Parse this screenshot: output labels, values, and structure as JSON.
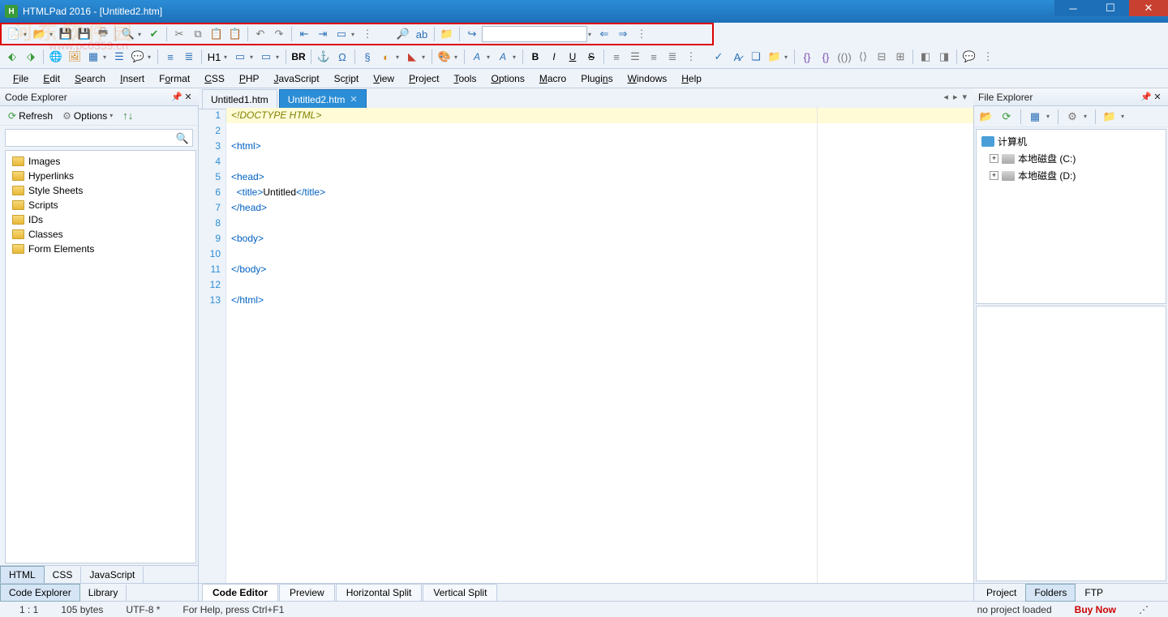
{
  "titlebar": {
    "app": "HTMLPad 2016",
    "doc": "[Untitled2.htm]"
  },
  "watermark": {
    "line1": "河 东 软 件 园",
    "line2": "www.pc0359.cn"
  },
  "menubar": [
    "File",
    "Edit",
    "Search",
    "Insert",
    "Format",
    "CSS",
    "PHP",
    "JavaScript",
    "Script",
    "View",
    "Project",
    "Tools",
    "Options",
    "Macro",
    "Plugins",
    "Windows",
    "Help"
  ],
  "code_explorer": {
    "title": "Code Explorer",
    "refresh": "Refresh",
    "options": "Options",
    "search_placeholder": "",
    "items": [
      "Images",
      "Hyperlinks",
      "Style Sheets",
      "Scripts",
      "IDs",
      "Classes",
      "Form Elements"
    ]
  },
  "tabs": {
    "inactive": "Untitled1.htm",
    "active": "Untitled2.htm"
  },
  "code": {
    "lines": [
      {
        "n": 1,
        "html": "<span class='doctype'>&lt;!DOCTYPE HTML&gt;</span>"
      },
      {
        "n": 2,
        "html": ""
      },
      {
        "n": 3,
        "html": "<span class='tag'>&lt;html&gt;</span>"
      },
      {
        "n": 4,
        "html": ""
      },
      {
        "n": 5,
        "html": "<span class='tag'>&lt;head&gt;</span>"
      },
      {
        "n": 6,
        "html": "  <span class='tag'>&lt;title&gt;</span><span class='txt'>Untitled</span><span class='tag'>&lt;/title&gt;</span>"
      },
      {
        "n": 7,
        "html": "<span class='tag'>&lt;/head&gt;</span>"
      },
      {
        "n": 8,
        "html": ""
      },
      {
        "n": 9,
        "html": "<span class='tag'>&lt;body&gt;</span>"
      },
      {
        "n": 10,
        "html": ""
      },
      {
        "n": 11,
        "html": "<span class='tag'>&lt;/body&gt;</span>"
      },
      {
        "n": 12,
        "html": ""
      },
      {
        "n": 13,
        "html": "<span class='tag'>&lt;/html&gt;</span>"
      }
    ]
  },
  "file_explorer": {
    "title": "File Explorer",
    "root": "计算机",
    "drives": [
      "本地磁盘 (C:)",
      "本地磁盘 (D:)"
    ]
  },
  "bottom_left_tabs": [
    "HTML",
    "CSS",
    "JavaScript"
  ],
  "panel_tabs": [
    "Code Explorer",
    "Library"
  ],
  "view_tabs": [
    "Code Editor",
    "Preview",
    "Horizontal Split",
    "Vertical Split"
  ],
  "right_tabs": [
    "Project",
    "Folders",
    "FTP"
  ],
  "status": {
    "pos": "1 : 1",
    "size": "105 bytes",
    "enc": "UTF-8 *",
    "help": "For Help, press Ctrl+F1",
    "proj": "no project loaded",
    "buy": "Buy Now"
  }
}
